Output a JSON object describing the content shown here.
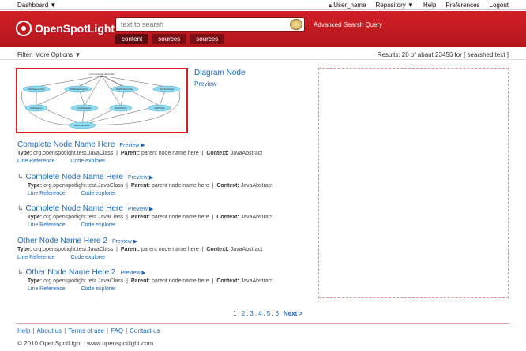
{
  "topbar": {
    "dashboard": "Dashboard ▼",
    "user": "User_name",
    "repository": "Repository ▼",
    "help": "Help",
    "preferences": "Preferences",
    "logout": "Logout"
  },
  "header": {
    "logo_text": "OpenSpotLight",
    "search_placeholder": "text to searsh",
    "advanced": "Advanced Searsh Query",
    "tabs": [
      "content",
      "sources",
      "sources"
    ]
  },
  "filter": {
    "label": "Filter:",
    "more": "More Options ▼",
    "results": "Results: 20 of abaut  23456 for [ searshed text ]"
  },
  "diagram": {
    "title": "Diagram Node",
    "preview": "Preview",
    "root": "com.censored.demo.dao",
    "nodes": [
      "DAOAgencyImpl",
      "DAOPayablesImpl",
      "DAOHistoricImpl",
      "DaoTurboImpl",
      "DAOAgency",
      "DAOPayables",
      "DAOHistoric",
      "DAOTurbo",
      "DAOConnection"
    ]
  },
  "results": [
    {
      "title": "Complete Node Name Here",
      "preview": "Preview ▶",
      "type": "org.openspotlight.test.JavaClass",
      "parent": "parent node name here",
      "context": "JavaAbstract",
      "link1": "Line Reference",
      "link2": "Code explorer",
      "child": false
    },
    {
      "title": "Complete Node Name Here",
      "preview": "Preview ▶",
      "type": "org.openspotlight.test.JavaClass",
      "parent": "parent node name here",
      "context": "JavaAbstract",
      "link1": "Line Reference",
      "link2": "Code explorer",
      "child": true
    },
    {
      "title": "Complete Node Name Here",
      "preview": "Preview ▶",
      "type": "org.openspotlight.test.JavaClass",
      "parent": "parent node name here",
      "context": "JavaAbstract",
      "link1": "Line Reference",
      "link2": "Code explorer",
      "child": true
    },
    {
      "title": "Other Node Name Here 2",
      "preview": "Preview ▶",
      "type": "org.openspotlight.test.JavaClass",
      "parent": "parent node name here",
      "context": "JavaAbstract",
      "link1": "Line Reference",
      "link2": "Code explorer",
      "child": false
    },
    {
      "title": "Other Node Name Here 2",
      "preview": "Preview ▶",
      "type": "org.openspotlight.test.JavaClass",
      "parent": "parent node name here",
      "context": "JavaAbstract",
      "link1": "Line Reference",
      "link2": "Code explorer",
      "child": true
    }
  ],
  "meta_labels": {
    "type": "Type:",
    "parent": "Parent:",
    "context": "Context:"
  },
  "pager": {
    "current": "1",
    "pages": [
      "2",
      "3",
      "4",
      "5",
      "6"
    ],
    "next": "Next >"
  },
  "footer": {
    "links": [
      "Help",
      "About us",
      "Terms of use",
      "FAQ",
      "Contact us"
    ],
    "copyright": "© 2010 OpenSpotLight : www.openspotlight.com"
  }
}
